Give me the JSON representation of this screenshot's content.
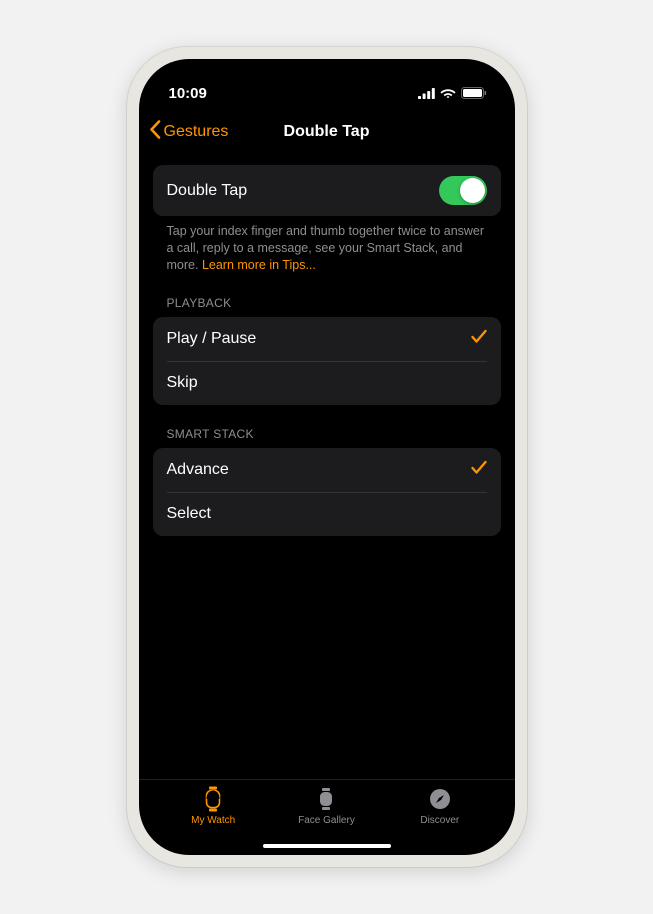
{
  "status": {
    "time": "10:09"
  },
  "nav": {
    "back": "Gestures",
    "title": "Double Tap"
  },
  "main_toggle": {
    "label": "Double Tap",
    "enabled": true
  },
  "description": {
    "text": "Tap your index finger and thumb together twice to answer a call, reply to a message, see your Smart Stack, and more. ",
    "link": "Learn more in Tips..."
  },
  "sections": [
    {
      "header": "PLAYBACK",
      "items": [
        {
          "label": "Play / Pause",
          "checked": true
        },
        {
          "label": "Skip",
          "checked": false
        }
      ]
    },
    {
      "header": "SMART STACK",
      "items": [
        {
          "label": "Advance",
          "checked": true
        },
        {
          "label": "Select",
          "checked": false
        }
      ]
    }
  ],
  "tabs": {
    "my_watch": "My Watch",
    "face_gallery": "Face Gallery",
    "discover": "Discover"
  },
  "colors": {
    "accent": "#ff9500",
    "toggle_on": "#34c759"
  }
}
